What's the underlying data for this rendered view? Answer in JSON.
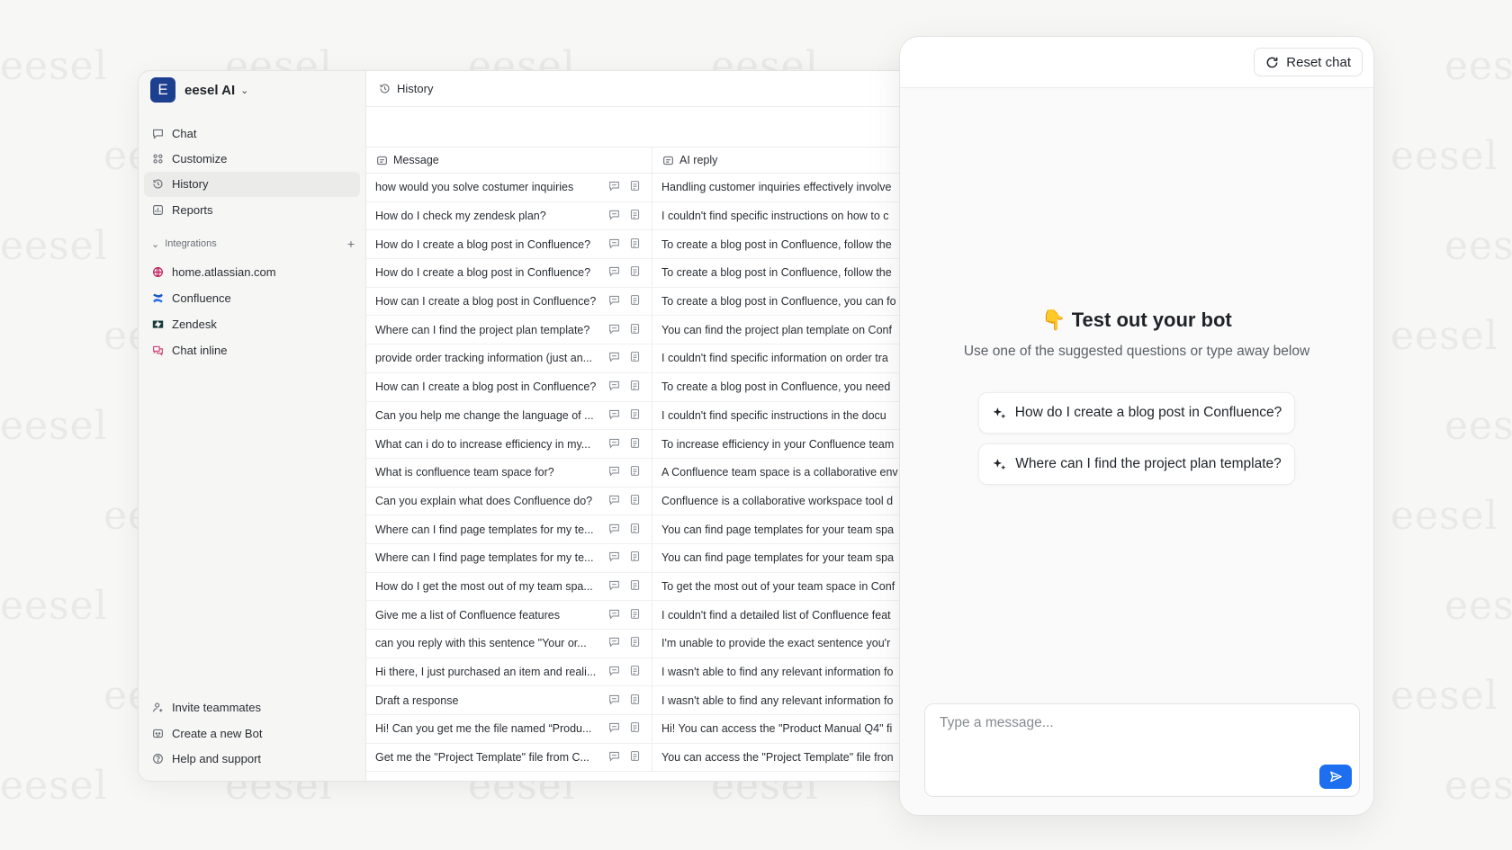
{
  "watermark": "eesel",
  "app": {
    "brand_initial": "E",
    "brand_name": "eesel AI",
    "nav": [
      {
        "label": "Chat",
        "icon": "chat-bubble-icon"
      },
      {
        "label": "Customize",
        "icon": "grid-icon"
      },
      {
        "label": "History",
        "icon": "history-icon"
      },
      {
        "label": "Reports",
        "icon": "reports-icon"
      }
    ],
    "integrations_label": "Integrations",
    "integrations": [
      {
        "label": "home.atlassian.com",
        "icon": "globe-icon"
      },
      {
        "label": "Confluence",
        "icon": "confluence-icon"
      },
      {
        "label": "Zendesk",
        "icon": "zendesk-icon"
      },
      {
        "label": "Chat inline",
        "icon": "chat-inline-icon"
      }
    ],
    "bottom_nav": [
      {
        "label": "Invite teammates",
        "icon": "invite-user-icon"
      },
      {
        "label": "Create a new Bot",
        "icon": "bot-icon"
      },
      {
        "label": "Help and support",
        "icon": "help-icon"
      }
    ]
  },
  "history": {
    "page_title": "History",
    "columns": {
      "message": "Message",
      "reply": "AI reply"
    },
    "rows": [
      {
        "message": "how would you solve costumer inquiries",
        "reply": "Handling customer inquiries effectively involve"
      },
      {
        "message": "How do I check my zendesk plan?",
        "reply": "I couldn't find specific instructions on how to c"
      },
      {
        "message": "How do I create a blog post in Confluence?",
        "reply": "To create a blog post in Confluence, follow the"
      },
      {
        "message": "How do I create a blog post in Confluence?",
        "reply": "To create a blog post in Confluence, follow the"
      },
      {
        "message": "How can I create a blog post in Confluence?",
        "reply": "To create a blog post in Confluence, you can fo"
      },
      {
        "message": "Where can I find the project plan template?",
        "reply": "You can find the project plan template on Conf"
      },
      {
        "message": "provide order tracking information (just an...",
        "reply": "I couldn't find specific information on order tra"
      },
      {
        "message": "How can I create a blog post in Confluence?",
        "reply": "To create a blog post in Confluence, you need"
      },
      {
        "message": "Can you help me change the language of ...",
        "reply": "I couldn't find specific instructions in the docu"
      },
      {
        "message": "What can i do to increase efficiency in my...",
        "reply": "To increase efficiency in your Confluence team"
      },
      {
        "message": "What is confluence team space for?",
        "reply": "A Confluence team space is a collaborative env"
      },
      {
        "message": "Can you explain what does Confluence do?",
        "reply": "Confluence is a collaborative workspace tool d"
      },
      {
        "message": "Where can I find page templates for my te...",
        "reply": "You can find page templates for your team spa"
      },
      {
        "message": "Where can I find page templates for my te...",
        "reply": "You can find page templates for your team spa"
      },
      {
        "message": "How do I get the most out of my team spa...",
        "reply": "To get the most out of your team space in Conf"
      },
      {
        "message": "Give me a list of Confluence features",
        "reply": "I couldn't find a detailed list of Confluence feat"
      },
      {
        "message": "can you reply with this sentence \"Your or...",
        "reply": "I'm unable to provide the exact sentence you'r"
      },
      {
        "message": "Hi there, I just purchased an item and reali...",
        "reply": "I wasn't able to find any relevant information fo"
      },
      {
        "message": "Draft a response",
        "reply": "I wasn't able to find any relevant information fo"
      },
      {
        "message": "Hi! Can you get me the file named “Produ...",
        "reply": "Hi! You can access the \"Product Manual Q4\" fi"
      },
      {
        "message": "Get me the \"Project Template\" file from C...",
        "reply": "You can access the \"Project Template\" file fron"
      }
    ]
  },
  "chat": {
    "reset_label": "Reset chat",
    "hero_title": "👇 Test out your bot",
    "hero_subtitle": "Use one of the suggested questions or type away below",
    "suggestions": [
      "How do I create a blog post in Confluence?",
      "Where can I find the project plan template?"
    ],
    "input_placeholder": "Type a message...",
    "accent_color": "#1d6ff0"
  }
}
